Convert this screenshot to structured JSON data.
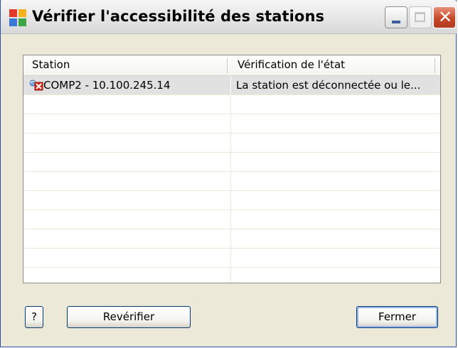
{
  "window": {
    "title": "Vérifier l'accessibilité des stations"
  },
  "icons": {
    "app": "avg-app-icon",
    "station": "network-station-error-icon",
    "minimize": "minimize-icon",
    "maximize": "maximize-icon",
    "close": "close-icon"
  },
  "table": {
    "columns": [
      "Station",
      "Vérification de l'état"
    ],
    "rows": [
      {
        "station": "COMP2 - 10.100.245.14",
        "status": "La station est déconnectée ou le...",
        "selected": true
      }
    ],
    "empty_row_count": 10
  },
  "buttons": {
    "help": "?",
    "recheck": "Revérifier",
    "close": "Fermer"
  },
  "colors": {
    "close_button": "#c7492a",
    "selected_row": "#e1e1e1",
    "window_border": "#2c4f9e"
  }
}
